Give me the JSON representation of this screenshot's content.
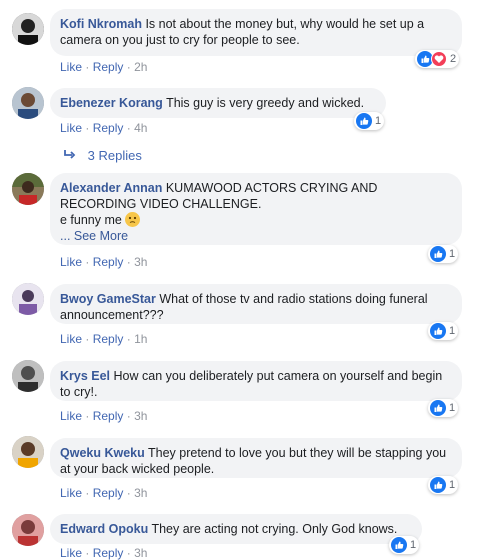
{
  "comments": [
    {
      "author": "Kofi Nkromah",
      "text": "Is not about the money but, why would he set up a camera on you just to cry for people to see.",
      "like": "Like",
      "reply": "Reply",
      "time": "2h",
      "reaction_count": "2"
    },
    {
      "author": "Ebenezer Korang",
      "text": "This guy is very greedy and wicked.",
      "like": "Like",
      "reply": "Reply",
      "time": "4h",
      "reaction_count": "1",
      "replies_label": "3 Replies"
    },
    {
      "author": "Alexander Annan",
      "text": "KUMAWOOD ACTORS CRYING AND RECORDING VIDEO CHALLENGE.",
      "text2": "e funny me",
      "see_more": "... See More",
      "like": "Like",
      "reply": "Reply",
      "time": "3h",
      "reaction_count": "1"
    },
    {
      "author": "Bwoy GameStar",
      "text": "What of those tv and radio stations doing funeral announcement???",
      "like": "Like",
      "reply": "Reply",
      "time": "1h",
      "reaction_count": "1"
    },
    {
      "author": "Krys Eel",
      "text": "How can you deliberately put camera on yourself and begin to cry!.",
      "like": "Like",
      "reply": "Reply",
      "time": "3h",
      "reaction_count": "1"
    },
    {
      "author": "Qweku Kweku",
      "text": "They pretend to love you but they will be stapping you at your back wicked people.",
      "like": "Like",
      "reply": "Reply",
      "time": "3h",
      "reaction_count": "1"
    },
    {
      "author": "Edward Opoku",
      "text": "They are acting not crying. Only God knows.",
      "like": "Like",
      "reply": "Reply",
      "time": "3h",
      "reaction_count": "1"
    }
  ],
  "colors": {
    "link": "#385898",
    "action": "#4267b2",
    "bubble": "#f2f3f5",
    "like": "#1877f2",
    "love": "#f33e58"
  }
}
